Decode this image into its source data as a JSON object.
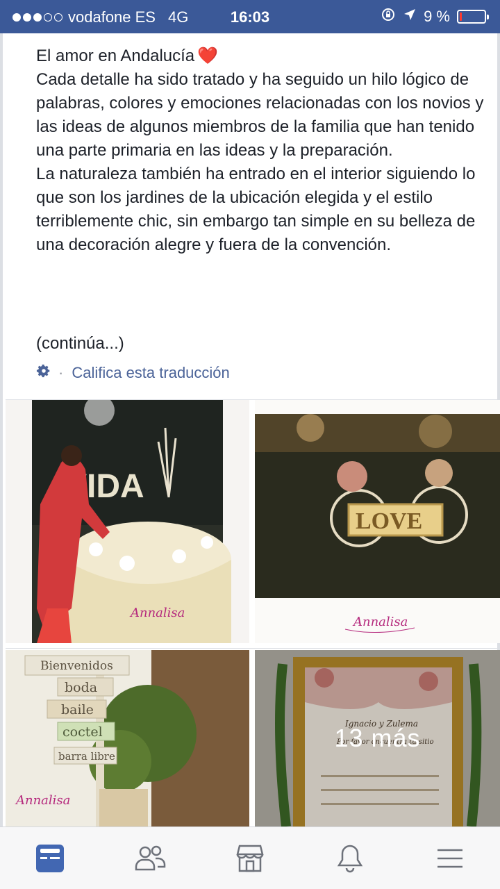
{
  "status_bar": {
    "carrier": "vodafone ES",
    "network": "4G",
    "time": "16:03",
    "battery": "9 %",
    "battery_level": 0.09,
    "signal_bars_filled": 3,
    "signal_bars_total": 5
  },
  "post": {
    "title_line": "El amor en Andalucía",
    "title_emoji": "❤️",
    "paragraph_1": "Cada detalle ha sido tratado y ha seguido un hilo lógico de palabras, colores y emociones relacionadas con los novios y las ideas de algunos miembros de la familia que han tenido una parte primaria en las ideas y la preparación.",
    "paragraph_2": "La naturaleza también ha entrado en el interior siguiendo lo que son los jardines de la ubicación elegida y el estilo terriblemente chic, sin embargo tan simple en su belleza de una decoración alegre y fuera de la convención.",
    "continue_text": "(continúa...)",
    "translation_link": "Califica esta traducción",
    "translation_separator": "·"
  },
  "photos": {
    "photo_1": {
      "sign_text": "VIDA",
      "watermark": "Annalisa"
    },
    "photo_2": {
      "sign_text": "LOVE",
      "watermark": "Annalisa"
    },
    "photo_3": {
      "signs": [
        "Bienvenidos",
        "boda",
        "baile",
        "coctel",
        "barra libre"
      ],
      "watermark": "Annalisa"
    },
    "photo_4": {
      "card_names": "Ignacio y Zulema",
      "card_sub": "Por favor encuentra tu sitio",
      "more_overlay": "13  más"
    }
  },
  "tabbar": {
    "tabs": [
      "news-feed-icon",
      "friends-icon",
      "marketplace-icon",
      "notifications-icon",
      "menu-icon"
    ],
    "active": "news-feed-icon"
  },
  "colors": {
    "status_bar_bg": "#3b5998",
    "accent": "#4267b2",
    "link": "#4b6398",
    "tab_inactive": "#6d717a"
  }
}
